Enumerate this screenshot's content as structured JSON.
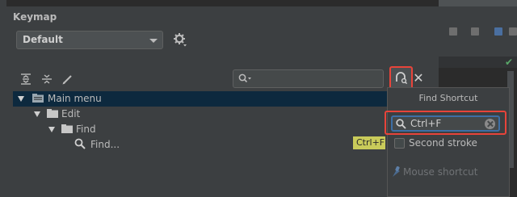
{
  "dialog": {
    "title": "Keymap",
    "scheme_selected": "Default"
  },
  "tree": {
    "items": [
      {
        "label": "Main menu",
        "level": 0,
        "selected": true
      },
      {
        "label": "Edit",
        "level": 1,
        "selected": false
      },
      {
        "label": "Find",
        "level": 2,
        "selected": false
      },
      {
        "label": "Find...",
        "level": 3,
        "selected": false,
        "shortcut": "Ctrl+F"
      }
    ]
  },
  "popup": {
    "title": "Find Shortcut",
    "shortcut_value": "Ctrl+F",
    "second_stroke_label": "Second stroke",
    "second_stroke_checked": false,
    "mouse_shortcut_label": "Mouse shortcut"
  },
  "colors": {
    "selection": "#0d293e",
    "highlight_border": "#e8443a",
    "focus_border": "#3d6fa5",
    "shortcut_tag": "#c9cb5a"
  }
}
